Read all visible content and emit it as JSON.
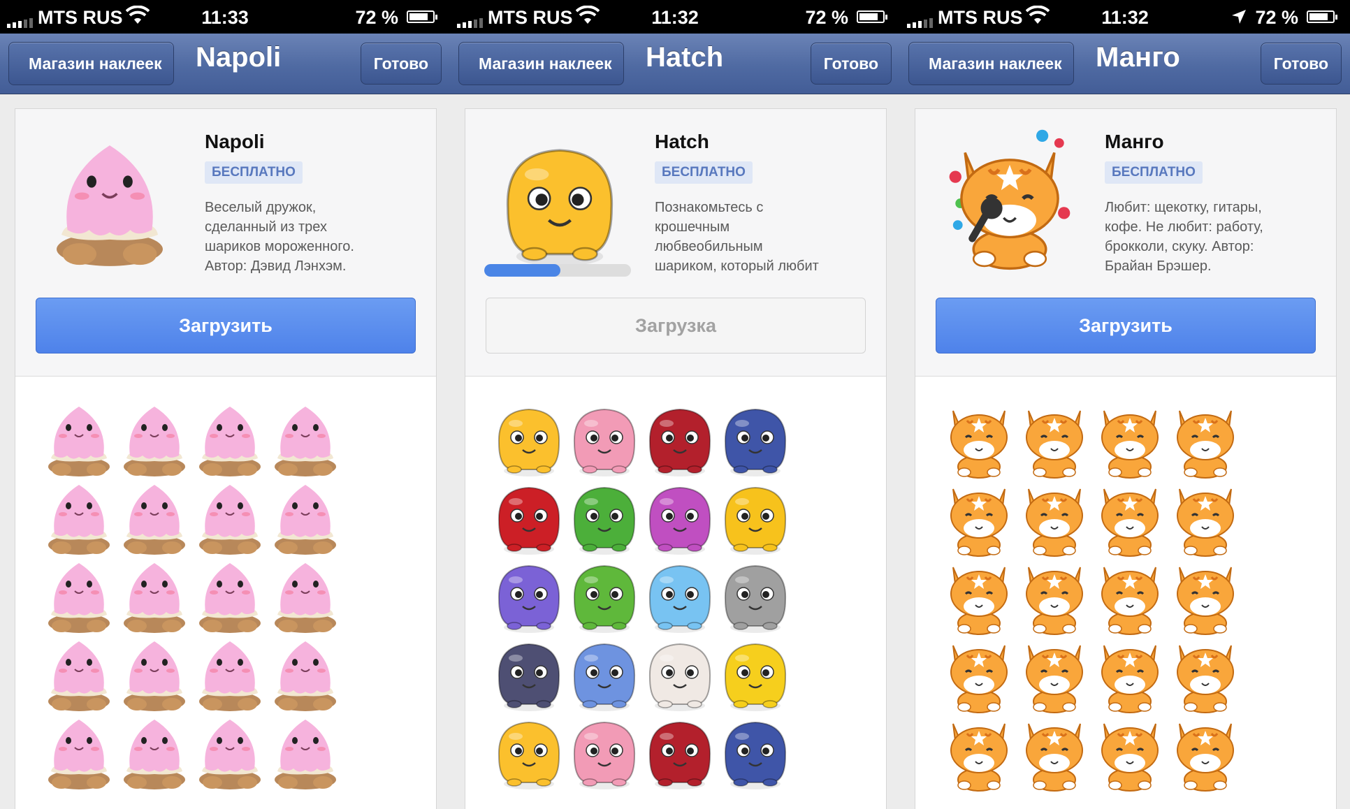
{
  "status": [
    {
      "carrier": "MTS RUS",
      "time": "11:33",
      "battery": "72 %",
      "location_arrow": false
    },
    {
      "carrier": "MTS RUS",
      "time": "11:32",
      "battery": "72 %",
      "location_arrow": false
    },
    {
      "carrier": "MTS RUS",
      "time": "11:32",
      "battery": "72 %",
      "location_arrow": true
    }
  ],
  "screens": [
    {
      "back": "Магазин наклеек",
      "nav_title": "Napoli",
      "done": "Готово",
      "pack_title": "Napoli",
      "badge": "БЕСПЛАТНО",
      "description": [
        "Веселый дружок,",
        "сделанный из трех",
        "шариков мороженного.",
        "Автор: Дэвид Лэнхэм."
      ],
      "button": "Загрузить",
      "button_state": "download",
      "sticker_kind": "napoli",
      "accent": "#f5aede"
    },
    {
      "back": "Магазин наклеек",
      "nav_title": "Hatch",
      "done": "Готово",
      "pack_title": "Hatch",
      "badge": "БЕСПЛАТНО",
      "description": [
        "Познакомьтесь с",
        "крошечным",
        "любвеобильным",
        "шариком, который любит"
      ],
      "button": "Загрузка",
      "button_state": "loading",
      "progress": 0.52,
      "sticker_kind": "hatch",
      "accent": "#fbc02d"
    },
    {
      "back": "Магазин наклеек",
      "nav_title": "Манго",
      "done": "Готово",
      "pack_title": "Манго",
      "badge": "БЕСПЛАТНО",
      "description": [
        "Любит: щекотку, гитары,",
        "кофе. Не любит: работу,",
        "брокколи, скуку. Автор:",
        "Брайан Брэшер."
      ],
      "button": "Загрузить",
      "button_state": "download",
      "sticker_kind": "mango",
      "accent": "#f7a23c"
    }
  ],
  "hatch_colors": [
    "#fbc02d",
    "#f29bb6",
    "#b3202c",
    "#3f55a8",
    "#cc1f26",
    "#4caf3a",
    "#c04fc1",
    "#f7c21c",
    "#7b62d6",
    "#5fb83b",
    "#78c3f2",
    "#a0a0a0",
    "#4e4f73",
    "#6e93e0",
    "#f0e9e4",
    "#f6cf1d"
  ]
}
